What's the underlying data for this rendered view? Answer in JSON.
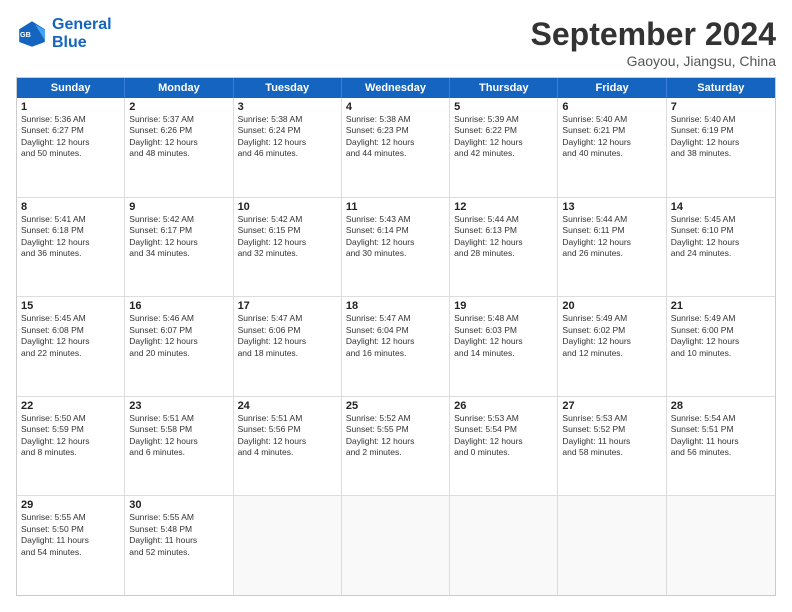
{
  "header": {
    "logo_line1": "General",
    "logo_line2": "Blue",
    "month": "September 2024",
    "location": "Gaoyou, Jiangsu, China"
  },
  "days": [
    "Sunday",
    "Monday",
    "Tuesday",
    "Wednesday",
    "Thursday",
    "Friday",
    "Saturday"
  ],
  "rows": [
    [
      {
        "day": "",
        "lines": []
      },
      {
        "day": "2",
        "lines": [
          "Sunrise: 5:37 AM",
          "Sunset: 6:26 PM",
          "Daylight: 12 hours",
          "and 48 minutes."
        ]
      },
      {
        "day": "3",
        "lines": [
          "Sunrise: 5:38 AM",
          "Sunset: 6:24 PM",
          "Daylight: 12 hours",
          "and 46 minutes."
        ]
      },
      {
        "day": "4",
        "lines": [
          "Sunrise: 5:38 AM",
          "Sunset: 6:23 PM",
          "Daylight: 12 hours",
          "and 44 minutes."
        ]
      },
      {
        "day": "5",
        "lines": [
          "Sunrise: 5:39 AM",
          "Sunset: 6:22 PM",
          "Daylight: 12 hours",
          "and 42 minutes."
        ]
      },
      {
        "day": "6",
        "lines": [
          "Sunrise: 5:40 AM",
          "Sunset: 6:21 PM",
          "Daylight: 12 hours",
          "and 40 minutes."
        ]
      },
      {
        "day": "7",
        "lines": [
          "Sunrise: 5:40 AM",
          "Sunset: 6:19 PM",
          "Daylight: 12 hours",
          "and 38 minutes."
        ]
      }
    ],
    [
      {
        "day": "1",
        "lines": [
          "Sunrise: 5:36 AM",
          "Sunset: 6:27 PM",
          "Daylight: 12 hours",
          "and 50 minutes."
        ]
      },
      {
        "day": "9",
        "lines": [
          "Sunrise: 5:42 AM",
          "Sunset: 6:17 PM",
          "Daylight: 12 hours",
          "and 34 minutes."
        ]
      },
      {
        "day": "10",
        "lines": [
          "Sunrise: 5:42 AM",
          "Sunset: 6:15 PM",
          "Daylight: 12 hours",
          "and 32 minutes."
        ]
      },
      {
        "day": "11",
        "lines": [
          "Sunrise: 5:43 AM",
          "Sunset: 6:14 PM",
          "Daylight: 12 hours",
          "and 30 minutes."
        ]
      },
      {
        "day": "12",
        "lines": [
          "Sunrise: 5:44 AM",
          "Sunset: 6:13 PM",
          "Daylight: 12 hours",
          "and 28 minutes."
        ]
      },
      {
        "day": "13",
        "lines": [
          "Sunrise: 5:44 AM",
          "Sunset: 6:11 PM",
          "Daylight: 12 hours",
          "and 26 minutes."
        ]
      },
      {
        "day": "14",
        "lines": [
          "Sunrise: 5:45 AM",
          "Sunset: 6:10 PM",
          "Daylight: 12 hours",
          "and 24 minutes."
        ]
      }
    ],
    [
      {
        "day": "8",
        "lines": [
          "Sunrise: 5:41 AM",
          "Sunset: 6:18 PM",
          "Daylight: 12 hours",
          "and 36 minutes."
        ]
      },
      {
        "day": "16",
        "lines": [
          "Sunrise: 5:46 AM",
          "Sunset: 6:07 PM",
          "Daylight: 12 hours",
          "and 20 minutes."
        ]
      },
      {
        "day": "17",
        "lines": [
          "Sunrise: 5:47 AM",
          "Sunset: 6:06 PM",
          "Daylight: 12 hours",
          "and 18 minutes."
        ]
      },
      {
        "day": "18",
        "lines": [
          "Sunrise: 5:47 AM",
          "Sunset: 6:04 PM",
          "Daylight: 12 hours",
          "and 16 minutes."
        ]
      },
      {
        "day": "19",
        "lines": [
          "Sunrise: 5:48 AM",
          "Sunset: 6:03 PM",
          "Daylight: 12 hours",
          "and 14 minutes."
        ]
      },
      {
        "day": "20",
        "lines": [
          "Sunrise: 5:49 AM",
          "Sunset: 6:02 PM",
          "Daylight: 12 hours",
          "and 12 minutes."
        ]
      },
      {
        "day": "21",
        "lines": [
          "Sunrise: 5:49 AM",
          "Sunset: 6:00 PM",
          "Daylight: 12 hours",
          "and 10 minutes."
        ]
      }
    ],
    [
      {
        "day": "15",
        "lines": [
          "Sunrise: 5:45 AM",
          "Sunset: 6:08 PM",
          "Daylight: 12 hours",
          "and 22 minutes."
        ]
      },
      {
        "day": "23",
        "lines": [
          "Sunrise: 5:51 AM",
          "Sunset: 5:58 PM",
          "Daylight: 12 hours",
          "and 6 minutes."
        ]
      },
      {
        "day": "24",
        "lines": [
          "Sunrise: 5:51 AM",
          "Sunset: 5:56 PM",
          "Daylight: 12 hours",
          "and 4 minutes."
        ]
      },
      {
        "day": "25",
        "lines": [
          "Sunrise: 5:52 AM",
          "Sunset: 5:55 PM",
          "Daylight: 12 hours",
          "and 2 minutes."
        ]
      },
      {
        "day": "26",
        "lines": [
          "Sunrise: 5:53 AM",
          "Sunset: 5:54 PM",
          "Daylight: 12 hours",
          "and 0 minutes."
        ]
      },
      {
        "day": "27",
        "lines": [
          "Sunrise: 5:53 AM",
          "Sunset: 5:52 PM",
          "Daylight: 11 hours",
          "and 58 minutes."
        ]
      },
      {
        "day": "28",
        "lines": [
          "Sunrise: 5:54 AM",
          "Sunset: 5:51 PM",
          "Daylight: 11 hours",
          "and 56 minutes."
        ]
      }
    ],
    [
      {
        "day": "22",
        "lines": [
          "Sunrise: 5:50 AM",
          "Sunset: 5:59 PM",
          "Daylight: 12 hours",
          "and 8 minutes."
        ]
      },
      {
        "day": "30",
        "lines": [
          "Sunrise: 5:55 AM",
          "Sunset: 5:48 PM",
          "Daylight: 11 hours",
          "and 52 minutes."
        ]
      },
      {
        "day": "",
        "lines": []
      },
      {
        "day": "",
        "lines": []
      },
      {
        "day": "",
        "lines": []
      },
      {
        "day": "",
        "lines": []
      },
      {
        "day": "",
        "lines": []
      }
    ]
  ],
  "row0_sunday": {
    "day": "1",
    "lines": [
      "Sunrise: 5:36 AM",
      "Sunset: 6:27 PM",
      "Daylight: 12 hours",
      "and 50 minutes."
    ]
  },
  "row1_sunday": {
    "day": "8",
    "lines": [
      "Sunrise: 5:41 AM",
      "Sunset: 6:18 PM",
      "Daylight: 12 hours",
      "and 36 minutes."
    ]
  },
  "row2_sunday": {
    "day": "15",
    "lines": [
      "Sunrise: 5:45 AM",
      "Sunset: 6:08 PM",
      "Daylight: 12 hours",
      "and 22 minutes."
    ]
  },
  "row3_sunday": {
    "day": "22",
    "lines": [
      "Sunrise: 5:50 AM",
      "Sunset: 5:59 PM",
      "Daylight: 12 hours",
      "and 8 minutes."
    ]
  },
  "row4_sunday": {
    "day": "29",
    "lines": [
      "Sunrise: 5:55 AM",
      "Sunset: 5:50 PM",
      "Daylight: 11 hours",
      "and 54 minutes."
    ]
  }
}
